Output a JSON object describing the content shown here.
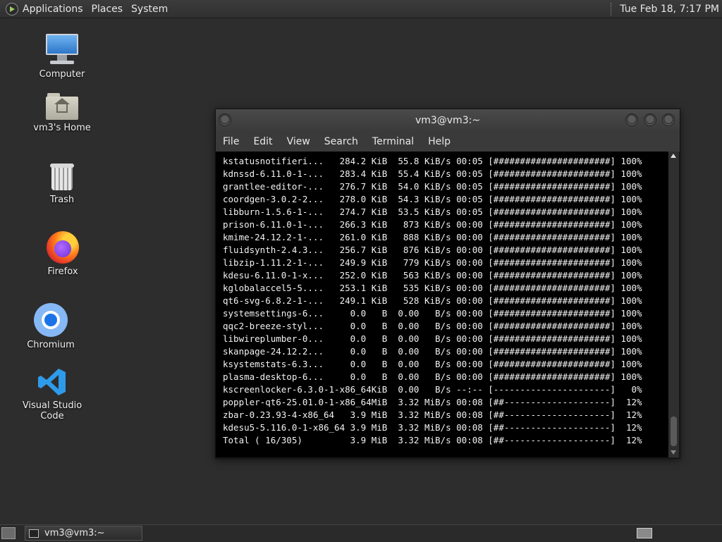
{
  "top_panel": {
    "menus": [
      "Applications",
      "Places",
      "System"
    ],
    "clock": "Tue Feb 18,  7:17 PM"
  },
  "desktop_icons": {
    "computer": "Computer",
    "home": "vm3's Home",
    "trash": "Trash",
    "firefox": "Firefox",
    "chromium": "Chromium",
    "vscode": "Visual Studio Code"
  },
  "terminal": {
    "title": "vm3@vm3:~",
    "menu": [
      "File",
      "Edit",
      "View",
      "Search",
      "Terminal",
      "Help"
    ],
    "lines": [
      "kstatusnotifieri...   284.2 KiB  55.8 KiB/s 00:05 [######################] 100%",
      "kdnssd-6.11.0-1-...   283.4 KiB  55.4 KiB/s 00:05 [######################] 100%",
      "grantlee-editor-...   276.7 KiB  54.0 KiB/s 00:05 [######################] 100%",
      "coordgen-3.0.2-2...   278.0 KiB  54.3 KiB/s 00:05 [######################] 100%",
      "libburn-1.5.6-1-...   274.7 KiB  53.5 KiB/s 00:05 [######################] 100%",
      "prison-6.11.0-1-...   266.3 KiB   873 KiB/s 00:00 [######################] 100%",
      "kmime-24.12.2-1-...   261.0 KiB   888 KiB/s 00:00 [######################] 100%",
      "fluidsynth-2.4.3...   256.7 KiB   876 KiB/s 00:00 [######################] 100%",
      "libzip-1.11.2-1-...   249.9 KiB   779 KiB/s 00:00 [######################] 100%",
      "kdesu-6.11.0-1-x...   252.0 KiB   563 KiB/s 00:00 [######################] 100%",
      "kglobalaccel5-5....   253.1 KiB   535 KiB/s 00:00 [######################] 100%",
      "qt6-svg-6.8.2-1-...   249.1 KiB   528 KiB/s 00:00 [######################] 100%",
      "systemsettings-6...     0.0   B  0.00   B/s 00:00 [######################] 100%",
      "qqc2-breeze-styl...     0.0   B  0.00   B/s 00:00 [######################] 100%",
      "libwireplumber-0...     0.0   B  0.00   B/s 00:00 [######################] 100%",
      "skanpage-24.12.2...     0.0   B  0.00   B/s 00:00 [######################] 100%",
      "ksystemstats-6.3...     0.0   B  0.00   B/s 00:00 [######################] 100%",
      "plasma-desktop-6...     0.0   B  0.00   B/s 00:00 [######################] 100%",
      "kscreenlocker-6.3.0-1-x86_64KiB  0.00   B/s --:-- [----------------------]   0%",
      "poppler-qt6-25.01.0-1-x86_64MiB  3.32 MiB/s 00:08 [##--------------------]  12%",
      "zbar-0.23.93-4-x86_64   3.9 MiB  3.32 MiB/s 00:08 [##--------------------]  12%",
      "kdesu5-5.116.0-1-x86_64 3.9 MiB  3.32 MiB/s 00:08 [##--------------------]  12%",
      "Total ( 16/305)         3.9 MiB  3.32 MiB/s 00:08 [##--------------------]  12%"
    ]
  },
  "taskbar": {
    "task_label": "vm3@vm3:~"
  }
}
